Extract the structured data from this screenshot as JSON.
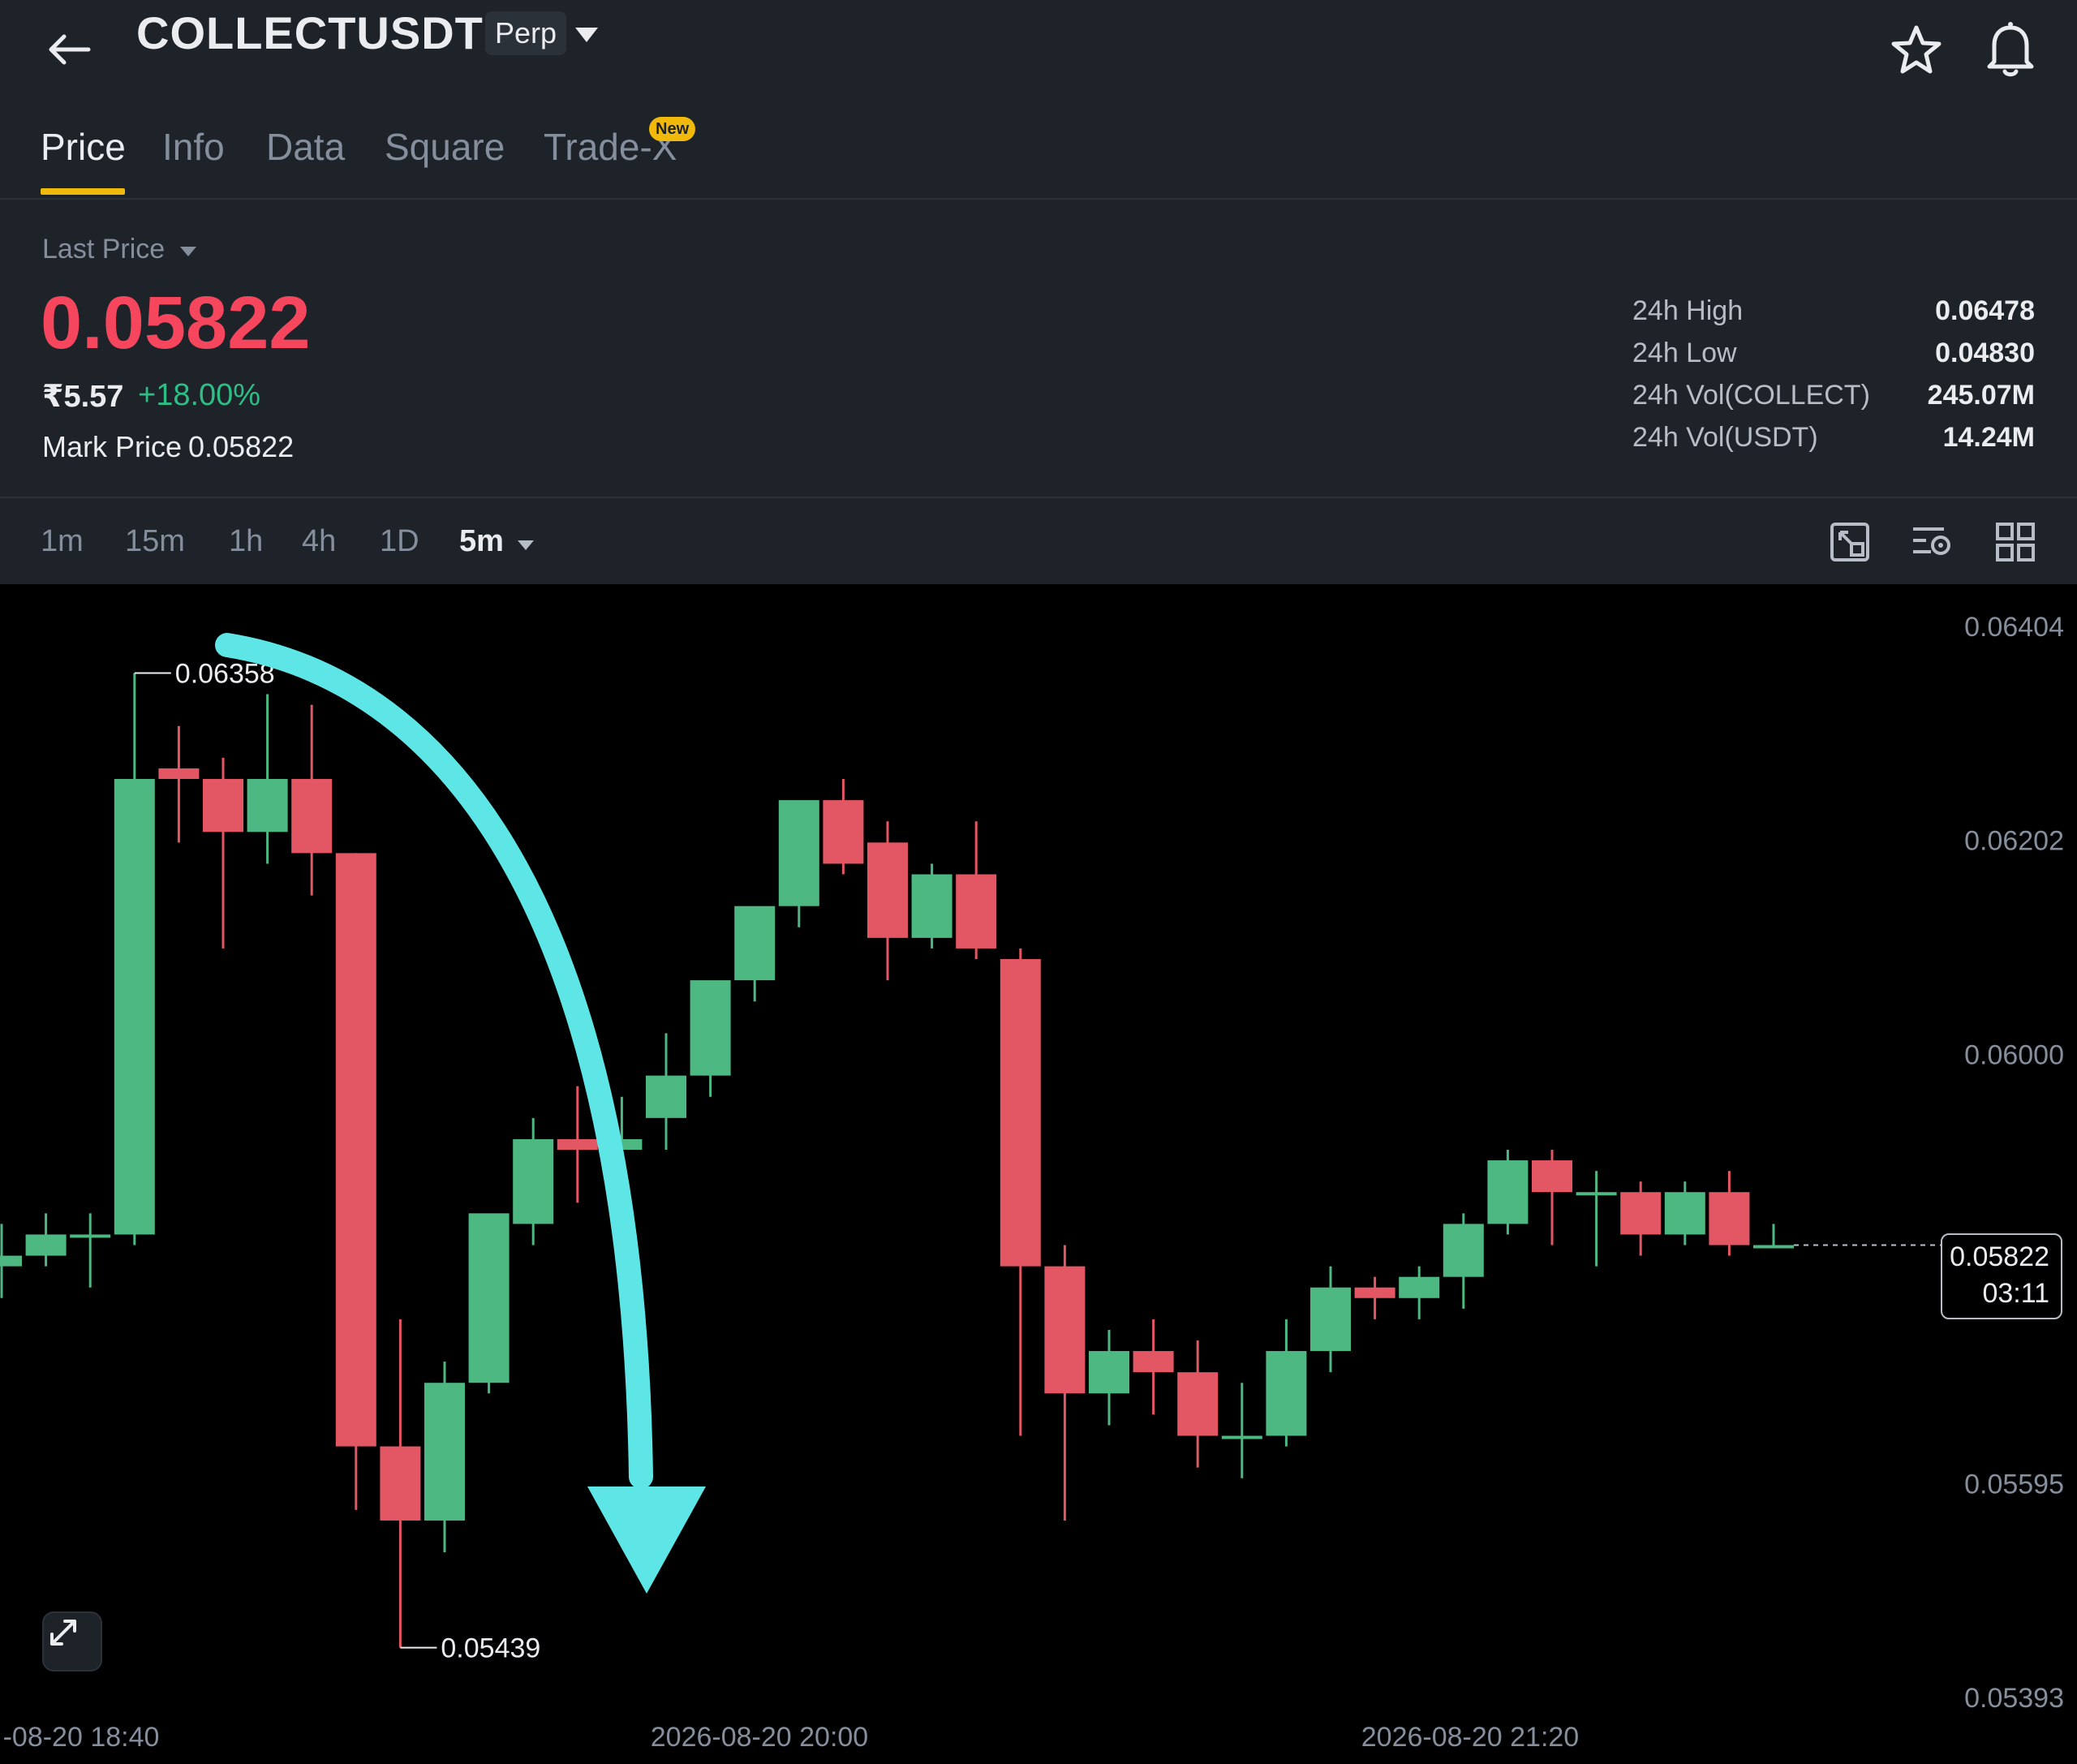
{
  "header": {
    "symbol": "COLLECTUSDT",
    "contract_badge": "Perp",
    "icons": [
      "back-arrow-icon",
      "chevron-down-icon",
      "star-icon",
      "bell-icon"
    ]
  },
  "tabs": [
    {
      "label": "Price",
      "active": true
    },
    {
      "label": "Info",
      "active": false
    },
    {
      "label": "Data",
      "active": false
    },
    {
      "label": "Square",
      "active": false
    },
    {
      "label": "Trade-X",
      "active": false,
      "badge": "New"
    }
  ],
  "ticker": {
    "last_price_label": "Last Price",
    "last_price": "0.05822",
    "inr_price": "₹5.57",
    "change": "+18.00%",
    "mark_price_label": "Mark Price",
    "mark_price": "0.05822",
    "stats": [
      {
        "label": "24h High",
        "value": "0.06478"
      },
      {
        "label": "24h Low",
        "value": "0.04830"
      },
      {
        "label": "24h Vol(COLLECT)",
        "value": "245.07M"
      },
      {
        "label": "24h Vol(USDT)",
        "value": "14.24M"
      }
    ]
  },
  "intervals": {
    "options": [
      "1m",
      "15m",
      "1h",
      "4h",
      "1D"
    ],
    "selected": "5m",
    "tool_icons": [
      "screenshot-icon",
      "indicator-settings-icon",
      "grid-layout-icon"
    ]
  },
  "chart_data": {
    "type": "candlestick",
    "y_axis_ticks": [
      "0.06404",
      "0.06202",
      "0.06000",
      "0.05595",
      "0.05393"
    ],
    "x_axis_ticks": [
      "-08-20 18:40",
      "2026-08-20 20:00",
      "2026-08-20 21:20"
    ],
    "high_label": "0.06358",
    "low_label": "0.05439",
    "current_price": "0.05822",
    "countdown": "03:11",
    "up_color": "#4eb883",
    "down_color": "#e35663",
    "annotation": "downward-arrow",
    "candles": [
      {
        "o": 0.058,
        "h": 0.0584,
        "l": 0.0577,
        "c": 0.0581
      },
      {
        "o": 0.0581,
        "h": 0.0585,
        "l": 0.058,
        "c": 0.0583
      },
      {
        "o": 0.0583,
        "h": 0.0585,
        "l": 0.0578,
        "c": 0.0583
      },
      {
        "o": 0.0583,
        "h": 0.0636,
        "l": 0.0582,
        "c": 0.0626
      },
      {
        "o": 0.0627,
        "h": 0.0631,
        "l": 0.062,
        "c": 0.0626
      },
      {
        "o": 0.0626,
        "h": 0.0628,
        "l": 0.061,
        "c": 0.0621
      },
      {
        "o": 0.0621,
        "h": 0.0634,
        "l": 0.0618,
        "c": 0.0626
      },
      {
        "o": 0.0626,
        "h": 0.0633,
        "l": 0.0615,
        "c": 0.0619
      },
      {
        "o": 0.0619,
        "h": 0.0619,
        "l": 0.0557,
        "c": 0.0563
      },
      {
        "o": 0.0563,
        "h": 0.0575,
        "l": 0.0544,
        "c": 0.0556
      },
      {
        "o": 0.0556,
        "h": 0.0571,
        "l": 0.0553,
        "c": 0.0569
      },
      {
        "o": 0.0569,
        "h": 0.0584,
        "l": 0.0568,
        "c": 0.0585
      },
      {
        "o": 0.0584,
        "h": 0.0594,
        "l": 0.0582,
        "c": 0.0592
      },
      {
        "o": 0.0592,
        "h": 0.0597,
        "l": 0.0586,
        "c": 0.0591
      },
      {
        "o": 0.0591,
        "h": 0.0596,
        "l": 0.0584,
        "c": 0.0592
      },
      {
        "o": 0.0594,
        "h": 0.0602,
        "l": 0.0591,
        "c": 0.0598
      },
      {
        "o": 0.0598,
        "h": 0.0606,
        "l": 0.0596,
        "c": 0.0607
      },
      {
        "o": 0.0607,
        "h": 0.0612,
        "l": 0.0605,
        "c": 0.0614
      },
      {
        "o": 0.0614,
        "h": 0.062,
        "l": 0.0612,
        "c": 0.0624
      },
      {
        "o": 0.0624,
        "h": 0.0626,
        "l": 0.0617,
        "c": 0.0618
      },
      {
        "o": 0.062,
        "h": 0.0622,
        "l": 0.0607,
        "c": 0.0611
      },
      {
        "o": 0.0611,
        "h": 0.0618,
        "l": 0.061,
        "c": 0.0617
      },
      {
        "o": 0.0617,
        "h": 0.0622,
        "l": 0.0609,
        "c": 0.061
      },
      {
        "o": 0.0609,
        "h": 0.061,
        "l": 0.0564,
        "c": 0.058
      },
      {
        "o": 0.058,
        "h": 0.0582,
        "l": 0.0556,
        "c": 0.0568
      },
      {
        "o": 0.0568,
        "h": 0.0574,
        "l": 0.0565,
        "c": 0.0572
      },
      {
        "o": 0.0572,
        "h": 0.0575,
        "l": 0.0566,
        "c": 0.057
      },
      {
        "o": 0.057,
        "h": 0.0573,
        "l": 0.0561,
        "c": 0.0564
      },
      {
        "o": 0.0564,
        "h": 0.0569,
        "l": 0.056,
        "c": 0.0564
      },
      {
        "o": 0.0564,
        "h": 0.0575,
        "l": 0.0563,
        "c": 0.0572
      },
      {
        "o": 0.0572,
        "h": 0.058,
        "l": 0.057,
        "c": 0.0578
      },
      {
        "o": 0.0578,
        "h": 0.0579,
        "l": 0.0575,
        "c": 0.0577
      },
      {
        "o": 0.0577,
        "h": 0.058,
        "l": 0.0575,
        "c": 0.0579
      },
      {
        "o": 0.0579,
        "h": 0.0585,
        "l": 0.0576,
        "c": 0.0584
      },
      {
        "o": 0.0584,
        "h": 0.0591,
        "l": 0.0583,
        "c": 0.059
      },
      {
        "o": 0.059,
        "h": 0.0591,
        "l": 0.0582,
        "c": 0.0587
      },
      {
        "o": 0.0587,
        "h": 0.0589,
        "l": 0.058,
        "c": 0.0587
      },
      {
        "o": 0.0587,
        "h": 0.0588,
        "l": 0.0581,
        "c": 0.0583
      },
      {
        "o": 0.0583,
        "h": 0.0588,
        "l": 0.0582,
        "c": 0.0587
      },
      {
        "o": 0.0587,
        "h": 0.0589,
        "l": 0.0581,
        "c": 0.0582
      },
      {
        "o": 0.0582,
        "h": 0.0584,
        "l": 0.0582,
        "c": 0.0582
      }
    ]
  }
}
